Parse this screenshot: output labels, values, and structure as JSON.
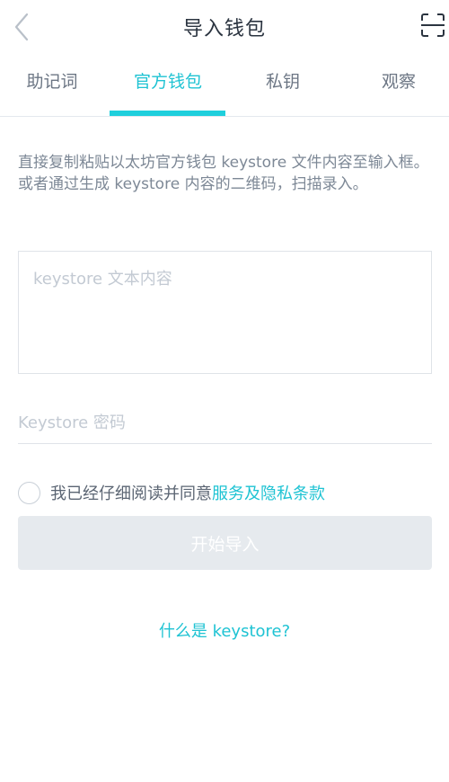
{
  "header": {
    "title": "导入钱包",
    "back_icon": "chevron-left-icon",
    "scan_icon": "scan-icon"
  },
  "tabs": [
    {
      "label": "助记词",
      "active": false
    },
    {
      "label": "官方钱包",
      "active": true
    },
    {
      "label": "私钥",
      "active": false
    },
    {
      "label": "观察",
      "active": false
    }
  ],
  "main": {
    "description": "直接复制粘贴以太坊官方钱包 keystore 文件内容至输入框。或者通过生成 keystore 内容的二维码，扫描录入。",
    "keystore_placeholder": "keystore 文本内容",
    "password_placeholder": "Keystore 密码",
    "agree_text": "我已经仔细阅读并同意",
    "terms_link": "服务及隐私条款",
    "start_button": "开始导入",
    "help_link": "什么是 keystore?"
  },
  "colors": {
    "accent": "#1fc3d3",
    "button_disabled": "#e6eaee"
  }
}
